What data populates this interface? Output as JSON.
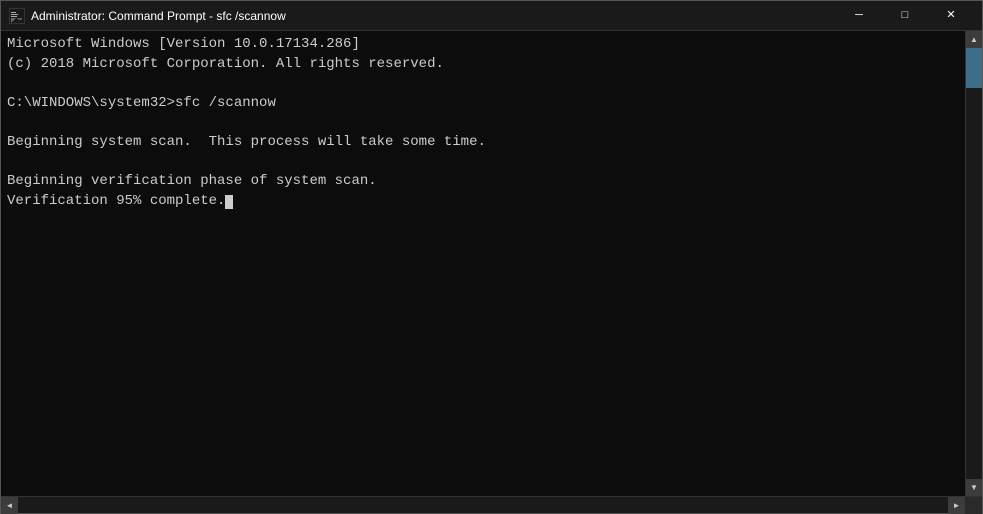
{
  "window": {
    "title": "Administrator: Command Prompt - sfc /scannow",
    "icon_label": "cmd-icon"
  },
  "titlebar_controls": {
    "minimize_label": "─",
    "maximize_label": "□",
    "close_label": "✕"
  },
  "console": {
    "lines": [
      "Microsoft Windows [Version 10.0.17134.286]",
      "(c) 2018 Microsoft Corporation. All rights reserved.",
      "",
      "C:\\WINDOWS\\system32>sfc /scannow",
      "",
      "Beginning system scan.  This process will take some time.",
      "",
      "Beginning verification phase of system scan.",
      "Verification 95% complete."
    ]
  }
}
